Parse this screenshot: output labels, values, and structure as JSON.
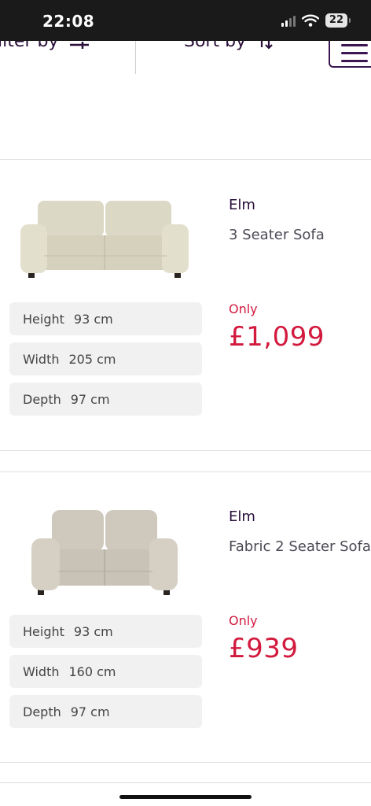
{
  "status_bar": {
    "time": "22:08",
    "battery": "22"
  },
  "toolbar": {
    "filter_label": "Filter by",
    "sort_label": "Sort by"
  },
  "products": [
    {
      "brand": "Elm",
      "name": "3 Seater Sofa",
      "dimensions": [
        {
          "label": "Height",
          "value": "93 cm"
        },
        {
          "label": "Width",
          "value": "205 cm"
        },
        {
          "label": "Depth",
          "value": "97 cm"
        }
      ],
      "price_prefix": "Only",
      "price": "£1,099"
    },
    {
      "brand": "Elm",
      "name": "Fabric 2 Seater Sofa",
      "dimensions": [
        {
          "label": "Height",
          "value": "93 cm"
        },
        {
          "label": "Width",
          "value": "160 cm"
        },
        {
          "label": "Depth",
          "value": "97 cm"
        }
      ],
      "price_prefix": "Only",
      "price": "£939"
    }
  ],
  "colors": {
    "accent": "#d21a3e",
    "brand_purple": "#2a0f3a",
    "dimension_bg": "#f1f1f1"
  }
}
